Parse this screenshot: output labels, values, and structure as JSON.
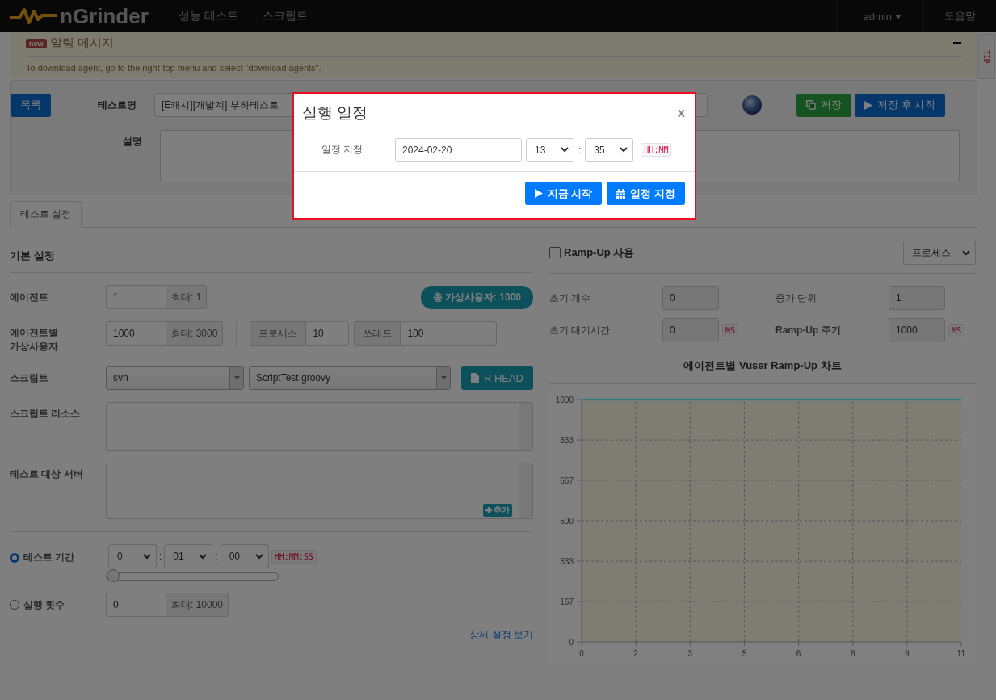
{
  "navbar": {
    "logo": "nGrinder",
    "menu": [
      {
        "label": "성능 테스트"
      },
      {
        "label": "스크립트"
      }
    ],
    "user": "admin",
    "help": "도움말"
  },
  "notice": {
    "badge": "new",
    "title": "알림 메시지",
    "message": "To download agent, go to the right-top menu and select \"download agents\"."
  },
  "tip_tab": "TIP",
  "test_form": {
    "list_button": "목록",
    "name_label": "테스트명",
    "name_value": "[E캐시][개발계] 부하테스트",
    "save_button": "저장",
    "save_start_button": "저장 후 시작",
    "description_label": "설명"
  },
  "tabs": [
    {
      "label": "테스트 설정",
      "selected": true
    }
  ],
  "basic": {
    "title": "기본 설정",
    "agent_label": "에이전트",
    "agent_value": "1",
    "agent_max": "최대: 1",
    "total_vusers": "총 가상사용자: 1000",
    "vuser_label": "에이전트별 가상사용자",
    "vuser_value": "1000",
    "vuser_max": "최대: 3000",
    "process_label": "프로세스",
    "process_value": "10",
    "thread_label": "쓰레드",
    "thread_value": "100",
    "script_label": "스크립트",
    "repo": "svn",
    "script": "ScriptTest.groovy",
    "revision_button": "R HEAD",
    "resources_label": "스크립트 리소스",
    "target_label": "테스트 대상 서버",
    "add_button": "추가",
    "duration": {
      "label": "테스트 기간",
      "selected": true,
      "hours": "0",
      "minutes": "01",
      "seconds": "00",
      "separator": ":",
      "format": "HH:MM:SS",
      "level": 0
    },
    "runs": {
      "label": "실행 횟수",
      "selected": false,
      "value": "0",
      "max": "최대: 10000"
    },
    "advanced_link": "상세 설정 보기"
  },
  "rampup": {
    "label": "Ramp-Up 사용",
    "checked": false,
    "type": "프로세스",
    "initial_count_label": "초기 개수",
    "initial_count": "0",
    "step_label": "증가 단위",
    "step": "1",
    "initial_wait_label": "초기 대기시간",
    "initial_wait": "0",
    "wait_unit": "MS",
    "interval_label": "Ramp-Up 주기",
    "interval": "1000",
    "interval_unit": "MS",
    "chart_title": "에이전트별 Vuser Ramp-Up 차트",
    "chart_data": {
      "type": "line",
      "x": [
        0,
        11
      ],
      "series": [
        {
          "color": "#2f7c82",
          "values": [
            1000,
            1000
          ]
        }
      ],
      "xlim": [
        0,
        11
      ],
      "ylim": [
        0,
        1000
      ],
      "xticks": [
        {
          "value": 0,
          "label": "0"
        },
        {
          "value": 1.571,
          "label": "2"
        },
        {
          "value": 3.143,
          "label": "3"
        },
        {
          "value": 4.714,
          "label": "5"
        },
        {
          "value": 6.286,
          "label": "6"
        },
        {
          "value": 7.857,
          "label": "8"
        },
        {
          "value": 9.429,
          "label": "9"
        },
        {
          "value": 11,
          "label": "11"
        }
      ],
      "yticks": [
        0,
        167,
        333,
        500,
        667,
        833,
        1000
      ],
      "grid": true
    }
  },
  "modal": {
    "title": "실행 일정",
    "close": "x",
    "schedule_label": "일정 지정",
    "date": "2024-02-20",
    "hour": "13",
    "separator": ":",
    "minute": "35",
    "format": "HH:MM",
    "start_now_button": "지금 시작",
    "schedule_button": "일정 지정"
  }
}
